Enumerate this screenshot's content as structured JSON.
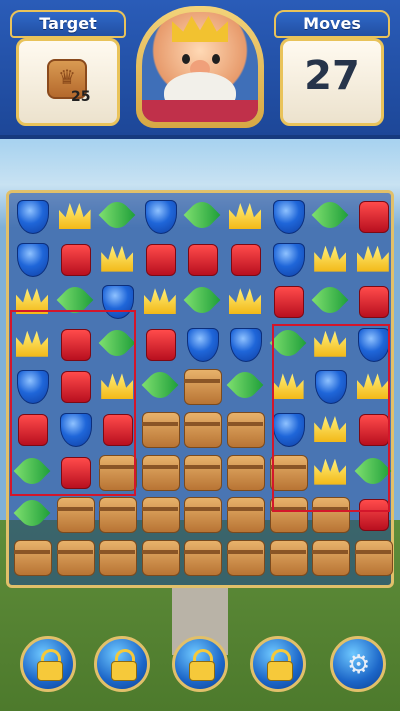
{
  "hud": {
    "target_label": "Target",
    "target_count": "25",
    "moves_label": "Moves",
    "moves_value": "27"
  },
  "board": {
    "rows": 9,
    "cols": 9,
    "grid": [
      [
        "shield",
        "crown",
        "leaf",
        "shield",
        "leaf",
        "crown",
        "shield",
        "leaf",
        "book"
      ],
      [
        "shield",
        "book",
        "crown",
        "book",
        "book",
        "book",
        "shield",
        "crown",
        "crown"
      ],
      [
        "crown",
        "leaf",
        "shield",
        "crown",
        "leaf",
        "crown",
        "book",
        "leaf",
        "book"
      ],
      [
        "crown",
        "book",
        "leaf",
        "book",
        "shield",
        "shield",
        "leaf",
        "crown",
        "shield"
      ],
      [
        "shield",
        "book",
        "crown",
        "leaf",
        "box",
        "leaf",
        "crown",
        "shield",
        "crown"
      ],
      [
        "book",
        "shield",
        "book",
        "box",
        "box",
        "box",
        "shield",
        "crown",
        "book"
      ],
      [
        "leaf",
        "book",
        "box",
        "box",
        "box",
        "box",
        "box",
        "crown",
        "leaf"
      ],
      [
        "leaf",
        "box",
        "box",
        "box",
        "box",
        "box",
        "box",
        "box",
        "book"
      ],
      [
        "box",
        "box",
        "box",
        "box",
        "box",
        "box",
        "box",
        "box",
        "box"
      ]
    ],
    "highlight_regions": [
      "left-column-group",
      "right-column-group"
    ]
  },
  "boosters": {
    "items": [
      {
        "name": "locked-booster-1",
        "icon": "lock-icon"
      },
      {
        "name": "locked-booster-2",
        "icon": "lock-icon"
      },
      {
        "name": "locked-booster-3",
        "icon": "lock-icon"
      },
      {
        "name": "locked-booster-4",
        "icon": "lock-icon"
      },
      {
        "name": "settings",
        "icon": "gear-icon"
      }
    ]
  },
  "colors": {
    "hud_blue": "#2a5cb8",
    "gold_trim": "#e1c06a",
    "highlight_red": "#d4162b"
  }
}
